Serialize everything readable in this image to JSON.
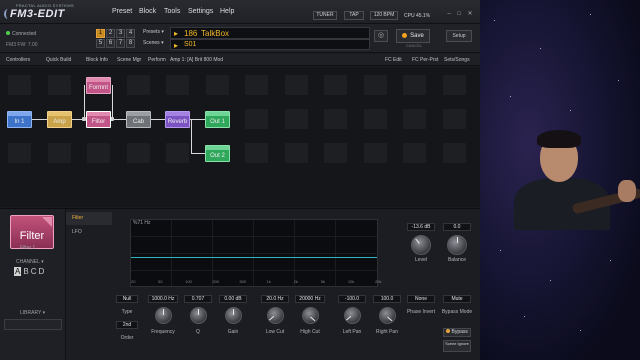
{
  "app": {
    "brand": "FRACTAL AUDIO SYSTEMS",
    "product": "FM3-EDIT",
    "menu": [
      "Preset",
      "Block",
      "Tools",
      "Settings",
      "Help"
    ],
    "tuner_label": "TUNER",
    "tap_label": "TAP",
    "bpm": "120 BPM",
    "cpu_label": "CPU",
    "cpu_value": "45.1%",
    "window_controls": [
      "–",
      "□",
      "✕"
    ]
  },
  "status": {
    "connected": "Connected",
    "firmware": "FM3 FW: 7.00"
  },
  "scenes": {
    "buttons": [
      "1",
      "2",
      "3",
      "4",
      "5",
      "6",
      "7",
      "8"
    ],
    "selected": "1"
  },
  "preset": {
    "presets_label": "Presets",
    "scenes_label": "Scenes",
    "preset_number": "186",
    "preset_name": "TalkBox",
    "scene_name": "S01",
    "save_label": "Save",
    "cancel_label": "CANCEL",
    "setup_label": "Setup",
    "color_led": "#f6a21c"
  },
  "tabs": [
    "Controllers",
    "Quick Build",
    "Block Info",
    "Scene Mgr",
    "Perform",
    "Amp 1: [A] Brit 800 Mod",
    "FC Edit",
    "FC Per-Prst",
    "Sets/Songs"
  ],
  "grid_blocks": [
    {
      "label": "In 1",
      "color": "#3d74c9"
    },
    {
      "label": "Amp",
      "color": "#c9a24a"
    },
    {
      "label": "Filter",
      "color": "#c25588"
    },
    {
      "label": "Cab",
      "color": "#6f7377"
    },
    {
      "label": "Reverb",
      "color": "#7b53c2"
    },
    {
      "label": "Out 1",
      "color": "#2fa85c"
    },
    {
      "label": "Formnt",
      "color": "#c25588"
    },
    {
      "label": "Out 2",
      "color": "#2fa85c"
    }
  ],
  "editor": {
    "block_name": "Filter",
    "block_instance": "Filter 1",
    "channel_label": "CHANNEL",
    "channels": [
      "A",
      "B",
      "C",
      "D"
    ],
    "selected_channel": "A",
    "library_label": "LIBRARY",
    "subtabs": [
      "Filter",
      "LFO"
    ],
    "graph_title": "%71 Hz",
    "graph_xlabels": [
      "20",
      "50",
      "100",
      "200",
      "500",
      "1k",
      "2k",
      "5k",
      "10k",
      "20k"
    ],
    "params": [
      {
        "name": "Type",
        "value": "Null"
      },
      {
        "name": "Order",
        "value": "2nd"
      },
      {
        "name": "Frequency",
        "value": "1000.0 Hz"
      },
      {
        "name": "Q",
        "value": "0.707"
      },
      {
        "name": "Gain",
        "value": "0.00 dB"
      },
      {
        "name": "Low Cut",
        "value": "20.0 Hz"
      },
      {
        "name": "High Cut",
        "value": "20000 Hz"
      },
      {
        "name": "Left Pan",
        "value": "-100.0"
      },
      {
        "name": "Right Pan",
        "value": "100.0"
      },
      {
        "name": "Phase Invert",
        "value": "None"
      },
      {
        "name": "Bypass Mode",
        "value": "Mute"
      },
      {
        "name": "Level",
        "value": "-13.6 dB"
      },
      {
        "name": "Balance",
        "value": "0.0"
      }
    ],
    "bypass_label": "Bypass",
    "scene_ignore_label": "Scene Ignore"
  },
  "colors": {
    "accent": "#f1b62a",
    "graph_curve": "#2fb6c2",
    "filter_block": "#c25588"
  }
}
